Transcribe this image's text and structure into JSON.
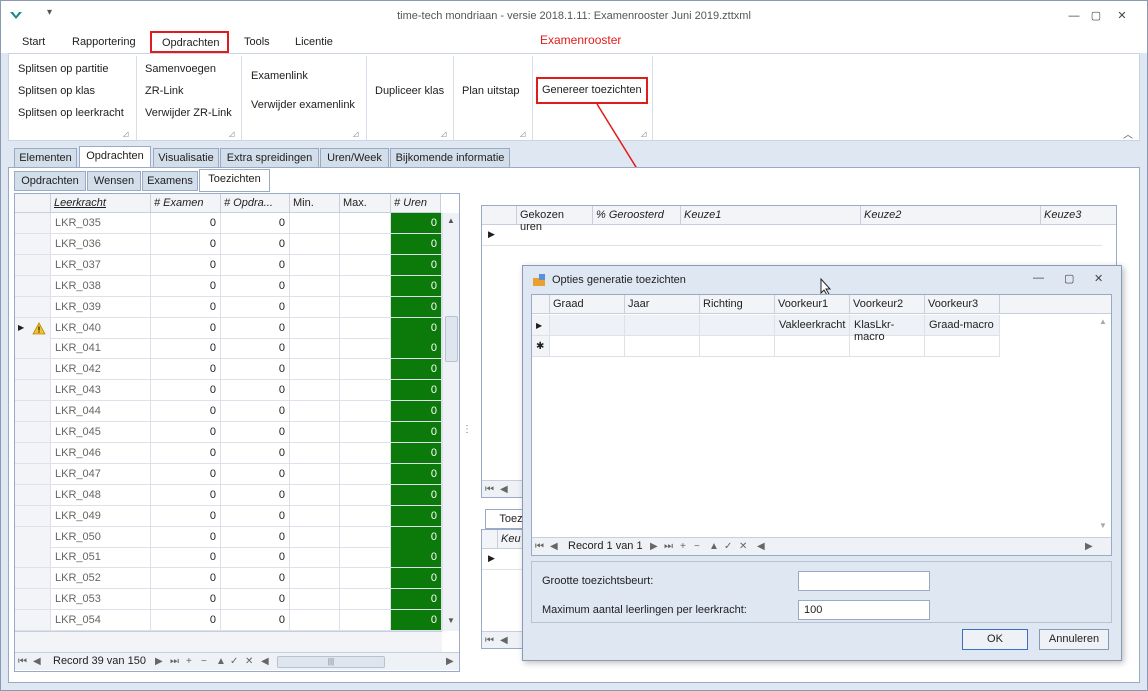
{
  "window": {
    "title": "time-tech mondriaan - versie 2018.1.11: Examenrooster Juni 2019.zttxml",
    "context_label": "Examenrooster"
  },
  "menu": {
    "items": [
      "Start",
      "Rapportering",
      "Opdrachten",
      "Tools",
      "Licentie"
    ]
  },
  "ribbon": {
    "group1": [
      "Splitsen op partitie",
      "Splitsen op klas",
      "Splitsen op leerkracht"
    ],
    "group2": [
      "Samenvoegen",
      "ZR-Link",
      "Verwijder ZR-Link"
    ],
    "group3": [
      "Examenlink",
      "Verwijder examenlink"
    ],
    "group4": [
      "Dupliceer klas"
    ],
    "group5": [
      "Plan uitstap"
    ],
    "group6": [
      "Genereer toezichten"
    ]
  },
  "main_tabs": [
    "Elementen",
    "Opdrachten",
    "Visualisatie",
    "Extra spreidingen",
    "Uren/Week",
    "Bijkomende informatie"
  ],
  "sub_tabs": [
    "Opdrachten",
    "Wensen",
    "Examens",
    "Toezichten"
  ],
  "left_grid": {
    "columns": [
      "Leerkracht",
      "# Examen",
      "# Opdra...",
      "Min.",
      "Max.",
      "# Uren"
    ],
    "rows": [
      {
        "name": "LKR_035",
        "examen": "0",
        "opdr": "0",
        "uren": "0"
      },
      {
        "name": "LKR_036",
        "examen": "0",
        "opdr": "0",
        "uren": "0"
      },
      {
        "name": "LKR_037",
        "examen": "0",
        "opdr": "0",
        "uren": "0"
      },
      {
        "name": "LKR_038",
        "examen": "0",
        "opdr": "0",
        "uren": "0"
      },
      {
        "name": "LKR_039",
        "examen": "0",
        "opdr": "0",
        "uren": "0"
      },
      {
        "name": "LKR_040",
        "examen": "0",
        "opdr": "0",
        "uren": "0"
      },
      {
        "name": "LKR_041",
        "examen": "0",
        "opdr": "0",
        "uren": "0"
      },
      {
        "name": "LKR_042",
        "examen": "0",
        "opdr": "0",
        "uren": "0"
      },
      {
        "name": "LKR_043",
        "examen": "0",
        "opdr": "0",
        "uren": "0"
      },
      {
        "name": "LKR_044",
        "examen": "0",
        "opdr": "0",
        "uren": "0"
      },
      {
        "name": "LKR_045",
        "examen": "0",
        "opdr": "0",
        "uren": "0"
      },
      {
        "name": "LKR_046",
        "examen": "0",
        "opdr": "0",
        "uren": "0"
      },
      {
        "name": "LKR_047",
        "examen": "0",
        "opdr": "0",
        "uren": "0"
      },
      {
        "name": "LKR_048",
        "examen": "0",
        "opdr": "0",
        "uren": "0"
      },
      {
        "name": "LKR_049",
        "examen": "0",
        "opdr": "0",
        "uren": "0"
      },
      {
        "name": "LKR_050",
        "examen": "0",
        "opdr": "0",
        "uren": "0"
      },
      {
        "name": "LKR_051",
        "examen": "0",
        "opdr": "0",
        "uren": "0"
      },
      {
        "name": "LKR_052",
        "examen": "0",
        "opdr": "0",
        "uren": "0"
      },
      {
        "name": "LKR_053",
        "examen": "0",
        "opdr": "0",
        "uren": "0"
      },
      {
        "name": "LKR_054",
        "examen": "0",
        "opdr": "0",
        "uren": "0"
      }
    ],
    "record_label": "Record 39 van 150"
  },
  "right_grid": {
    "columns": [
      "Gekozen uren",
      "% Geroosterd",
      "Keuze1",
      "Keuze2",
      "Keuze3"
    ]
  },
  "right_lower": {
    "tab_label": "Toezic",
    "column_partial": "Keu"
  },
  "dialog": {
    "title": "Opties generatie toezichten",
    "columns": [
      "Graad",
      "Jaar",
      "Richting",
      "Voorkeur1",
      "Voorkeur2",
      "Voorkeur3"
    ],
    "row": [
      "",
      "",
      "",
      "Vakleerkracht",
      "KlasLkr-macro",
      "Graad-macro"
    ],
    "record_label": "Record 1 van 1",
    "field1_label": "Grootte toezichtsbeurt:",
    "field1_value": "",
    "field2_label": "Maximum aantal leerlingen per leerkracht:",
    "field2_value": "100",
    "ok_label": "OK",
    "cancel_label": "Annuleren"
  },
  "colors": {
    "highlight": "#e21b1b",
    "green_cell": "#0b7a0b"
  }
}
